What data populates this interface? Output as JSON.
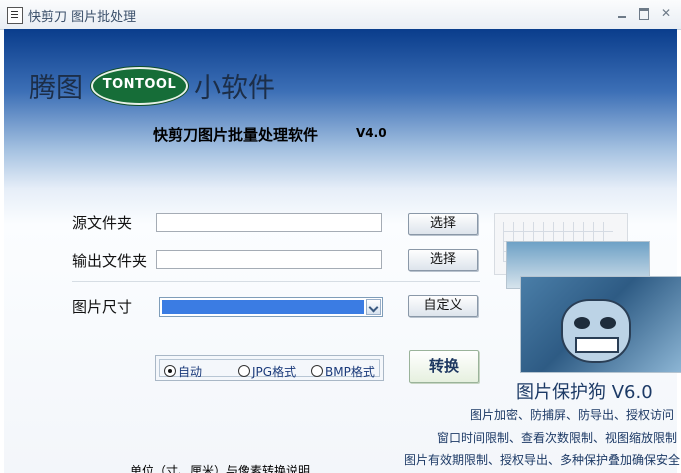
{
  "window": {
    "title": "快剪刀  图片批处理"
  },
  "brand": {
    "left_text": "腾图",
    "logo_text": "TONTOOL",
    "right_text": "小软件"
  },
  "product": {
    "title": "快剪刀图片批量处理软件",
    "version": "V4.0"
  },
  "form": {
    "source_label": "源文件夹",
    "source_value": "",
    "source_button": "选择",
    "output_label": "输出文件夹",
    "output_value": "",
    "output_button": "选择",
    "size_label": "图片尺寸",
    "size_selected": "",
    "custom_button": "自定义",
    "formats": [
      {
        "label": "自动",
        "checked": true
      },
      {
        "label": "JPG格式",
        "checked": false
      },
      {
        "label": "BMP格式",
        "checked": false
      }
    ],
    "convert_button": "转换"
  },
  "ad": {
    "title": "图片保护狗  V6.0",
    "lines": [
      "图片加密、防捕屏、防导出、授权访问",
      "窗口时间限制、查看次数限制、视图缩放限制",
      "图片有效期限制、授权导出、多种保护叠加确保安全"
    ]
  },
  "footer": {
    "link_text": "单位（寸、厘米）与像素转换说明"
  }
}
